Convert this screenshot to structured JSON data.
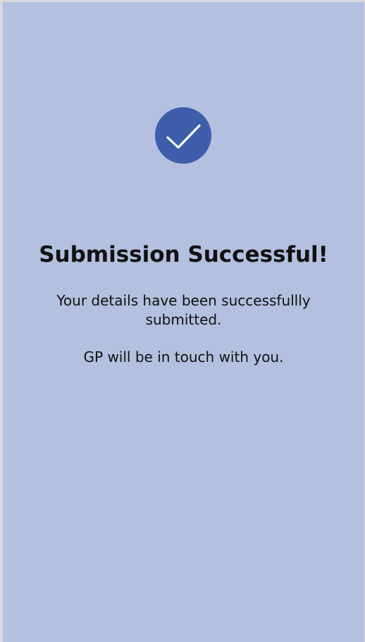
{
  "confirmation": {
    "icon": "checkmark-icon",
    "title": "Submission Successful!",
    "message": "Your details have been successfullly submitted.",
    "note": "GP will be in touch with you."
  },
  "colors": {
    "background": "#b3c0df",
    "icon_circle": "#3e5eab",
    "icon_check": "#ffffff",
    "text": "#111111",
    "frame": "#d9d9de"
  }
}
